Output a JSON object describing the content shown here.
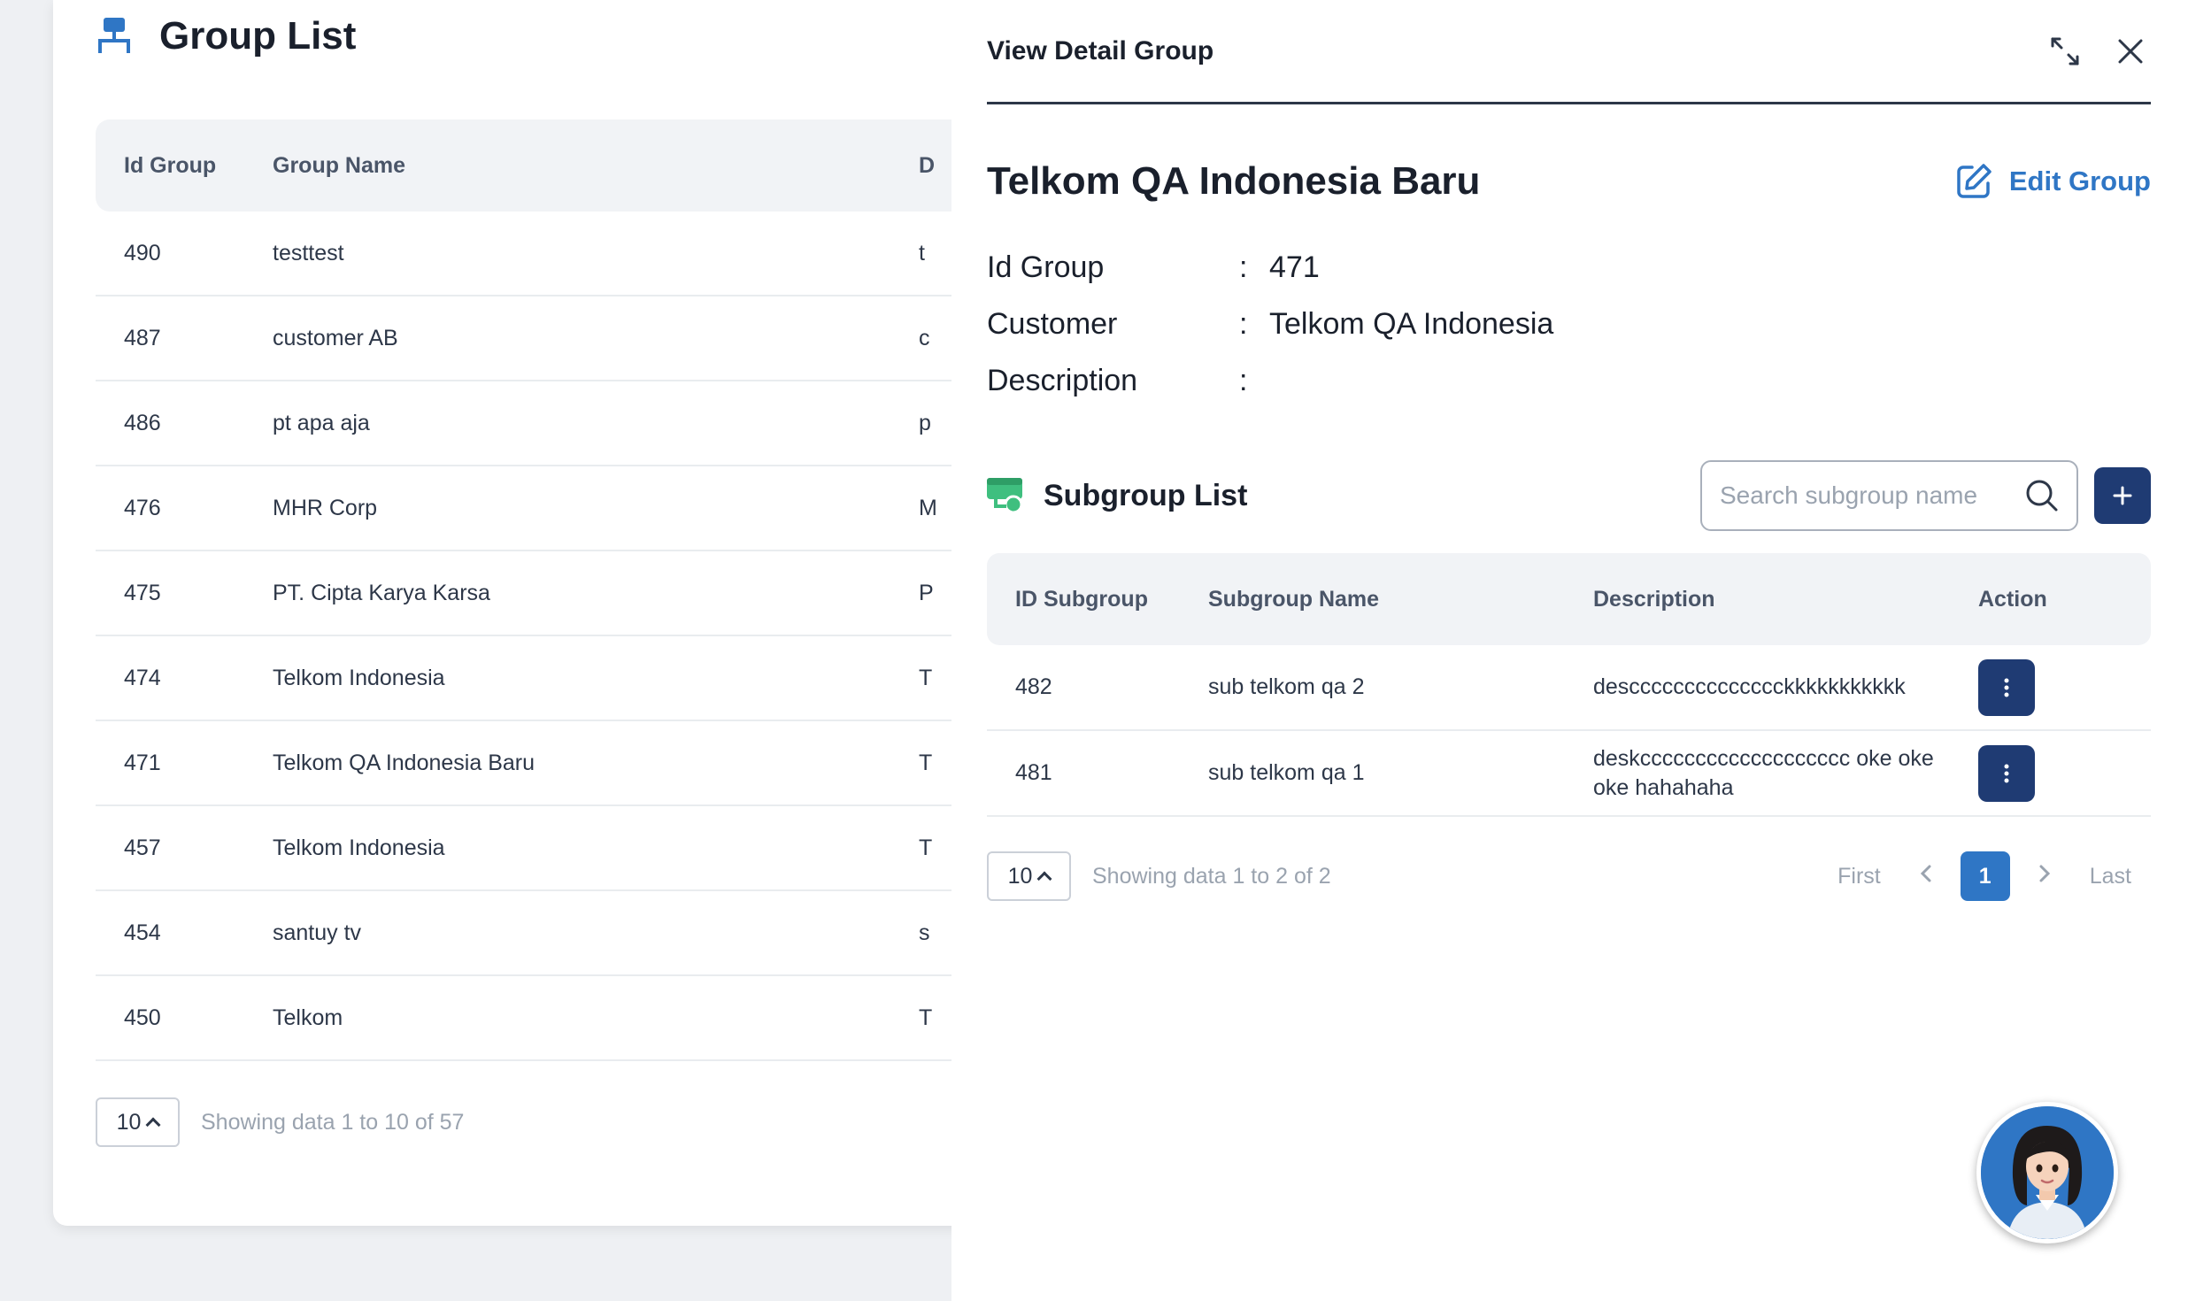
{
  "background": {
    "title": "Group List",
    "table": {
      "headers": [
        "Id Group",
        "Group Name",
        "Description"
      ],
      "rows": [
        {
          "id": "490",
          "name": "testtest",
          "third": "t"
        },
        {
          "id": "487",
          "name": "customer AB",
          "third": "c"
        },
        {
          "id": "486",
          "name": "pt apa aja",
          "third": "p"
        },
        {
          "id": "476",
          "name": "MHR Corp",
          "third": "M"
        },
        {
          "id": "475",
          "name": "PT. Cipta Karya Karsa",
          "third": "P"
        },
        {
          "id": "474",
          "name": "Telkom Indonesia",
          "third": "T"
        },
        {
          "id": "471",
          "name": "Telkom QA Indonesia Baru",
          "third": "T"
        },
        {
          "id": "457",
          "name": "Telkom Indonesia",
          "third": "T"
        },
        {
          "id": "454",
          "name": "santuy tv",
          "third": "s"
        },
        {
          "id": "450",
          "name": "Telkom",
          "third": "T"
        }
      ]
    },
    "page_size": "10",
    "showing": "Showing data 1 to 10 of 57"
  },
  "drawer": {
    "title": "View Detail Group",
    "group_name": "Telkom QA Indonesia Baru",
    "edit_label": "Edit Group",
    "info": [
      {
        "label": "Id Group",
        "value": "471"
      },
      {
        "label": "Customer",
        "value": "Telkom QA Indonesia"
      },
      {
        "label": "Description",
        "value": ""
      }
    ],
    "subgroup": {
      "title": "Subgroup List",
      "search_placeholder": "Search subgroup name",
      "headers": [
        "ID Subgroup",
        "Subgroup Name",
        "Description",
        "Action"
      ],
      "rows": [
        {
          "id": "482",
          "name": "sub telkom qa 2",
          "description": "descccccccccccccckkkkkkkkkkk"
        },
        {
          "id": "481",
          "name": "sub telkom qa 1",
          "description": "deskccccccccccccccccccc oke oke oke hahahaha"
        }
      ],
      "page_size": "10",
      "showing": "Showing data 1 to 2 of 2",
      "pager": {
        "first": "First",
        "current": "1",
        "last": "Last"
      }
    }
  },
  "colors": {
    "primary_dark": "#1f3b73",
    "accent_blue": "#2f76c5",
    "subgroup_icon": "#3fbf7f"
  }
}
